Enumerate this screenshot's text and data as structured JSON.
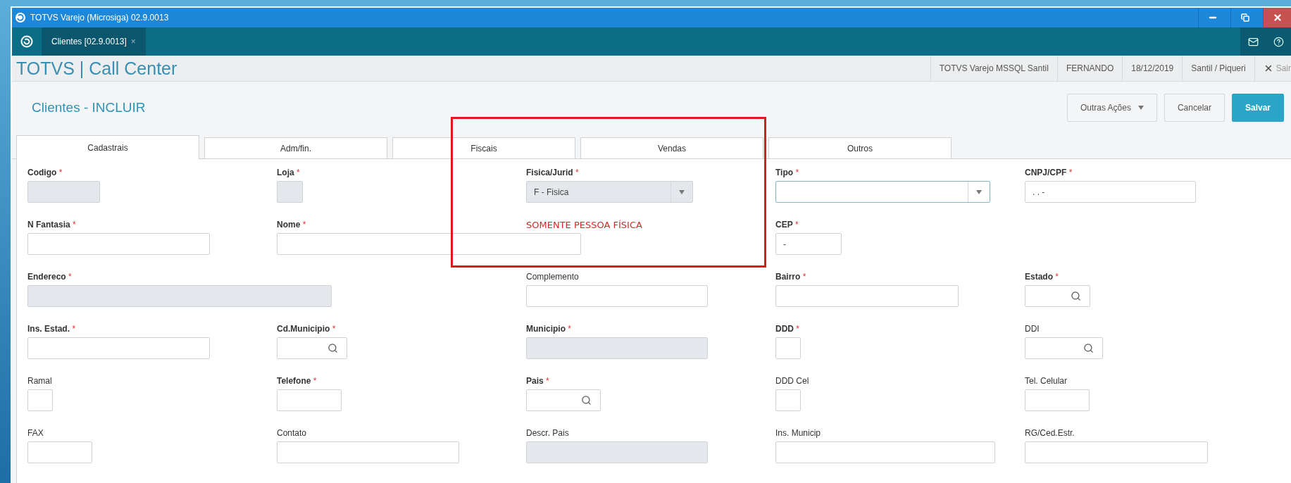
{
  "window": {
    "title": "TOTVS Varejo (Microsiga) 02.9.0013"
  },
  "app_tabs": [
    {
      "label": "Clientes [02.9.0013]",
      "close": "×",
      "selected": true
    }
  ],
  "header": {
    "title": "TOTVS | Call Center",
    "info": [
      "TOTVS Varejo MSSQL Santil",
      "FERNANDO",
      "18/12/2019",
      "Santil / Piqueri"
    ],
    "exit": "Sair"
  },
  "page": {
    "title": "Clientes - INCLUIR",
    "actions": [
      {
        "label": "Outras Ações",
        "kind": "menu"
      },
      {
        "label": "Cancelar",
        "kind": "plain"
      },
      {
        "label": "Salvar",
        "kind": "primary"
      }
    ]
  },
  "tabs": [
    {
      "label": "Cadastrais",
      "selected": true
    },
    {
      "label": "Adm/fin.",
      "selected": false
    },
    {
      "label": "Fiscais",
      "selected": false
    },
    {
      "label": "Vendas",
      "selected": false
    },
    {
      "label": "Outros",
      "selected": false
    }
  ],
  "rows": [
    [
      {
        "kind": "text",
        "label": "Codigo",
        "asterisk": "*",
        "disabled": true,
        "focused": false
      },
      {
        "kind": "text",
        "label": "Loja",
        "asterisk": "*",
        "disabled": true,
        "focused": false
      },
      {
        "kind": "select",
        "label": "Fisica/Jurid",
        "asterisk": "*",
        "value": "F - Fisica",
        "disabled": true,
        "focused": false
      },
      {
        "kind": "select",
        "label": "Tipo",
        "asterisk": "*",
        "disabled": false,
        "focused": true
      },
      {
        "kind": "text",
        "label": "CNPJ/CPF",
        "asterisk": "*",
        "value": ". . -",
        "disabled": false,
        "focused": false
      }
    ],
    [
      {
        "kind": "text",
        "label": "N Fantasia",
        "asterisk": "*",
        "disabled": false,
        "focused": false
      },
      {
        "kind": "text",
        "label": "Nome",
        "asterisk": "*",
        "disabled": false,
        "focused": false
      },
      {
        "kind": "note",
        "text": "SOMENTE PESSOA FÍSICA"
      },
      {
        "kind": "text",
        "label": "CEP",
        "asterisk": "*",
        "value": "-",
        "disabled": false,
        "focused": false
      },
      null
    ],
    [
      {
        "kind": "text",
        "label": "Endereco",
        "asterisk": "*",
        "disabled": true,
        "focused": false
      },
      null,
      {
        "kind": "text",
        "label": "Complemento",
        "disabled": false,
        "focused": false
      },
      {
        "kind": "text",
        "label": "Bairro",
        "asterisk": "*",
        "disabled": false,
        "focused": false
      },
      {
        "kind": "lookup",
        "label": "Estado",
        "asterisk": "*",
        "disabled": false,
        "focused": false
      }
    ],
    [
      {
        "kind": "text",
        "label": "Ins. Estad.",
        "asterisk": "*",
        "disabled": false,
        "focused": false
      },
      {
        "kind": "lookup",
        "label": "Cd.Municipio",
        "asterisk": "*",
        "disabled": false,
        "focused": false
      },
      {
        "kind": "text",
        "label": "Municipio",
        "asterisk": "*",
        "disabled": true,
        "focused": false
      },
      {
        "kind": "text",
        "label": "DDD",
        "asterisk": "*",
        "disabled": false,
        "focused": false
      },
      {
        "kind": "lookup",
        "label": "DDI",
        "disabled": false,
        "focused": false
      }
    ],
    [
      {
        "kind": "text",
        "label": "Ramal",
        "disabled": false,
        "focused": false
      },
      {
        "kind": "text",
        "label": "Telefone",
        "asterisk": "*",
        "disabled": false,
        "focused": false
      },
      {
        "kind": "lookup",
        "label": "Pais",
        "asterisk": "*",
        "disabled": false,
        "focused": false
      },
      {
        "kind": "text",
        "label": "DDD Cel",
        "disabled": false,
        "focused": false
      },
      {
        "kind": "text",
        "label": "Tel. Celular",
        "disabled": false,
        "focused": false
      }
    ],
    [
      {
        "kind": "text",
        "label": "FAX",
        "disabled": false,
        "focused": false
      },
      {
        "kind": "text",
        "label": "Contato",
        "disabled": false,
        "focused": false
      },
      {
        "kind": "text",
        "label": "Descr. Pais",
        "disabled": true,
        "focused": false
      },
      {
        "kind": "text",
        "label": "Ins. Municip",
        "disabled": false,
        "focused": false
      },
      {
        "kind": "text",
        "label": "RG/Ced.Estr.",
        "disabled": false,
        "focused": false
      }
    ]
  ]
}
